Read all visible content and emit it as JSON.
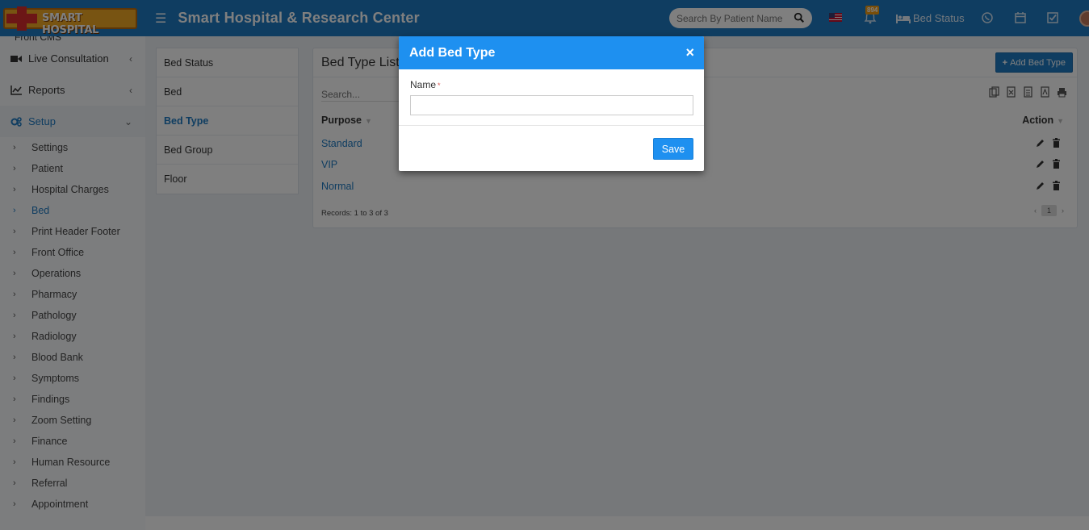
{
  "header": {
    "logo_text": "SMART HOSPITAL",
    "site_title": "Smart Hospital & Research Center",
    "search_placeholder": "Search By Patient Name",
    "notification_count": "894",
    "bed_status_label": "Bed Status",
    "brand_color": "#1e7ac2"
  },
  "sidebar": {
    "partial_top": "Front CMS",
    "items": [
      {
        "label": "Live Consultation",
        "icon": "video-camera-icon"
      },
      {
        "label": "Reports",
        "icon": "line-chart-icon"
      },
      {
        "label": "Setup",
        "icon": "gears-icon"
      }
    ],
    "setup_sub": [
      "Settings",
      "Patient",
      "Hospital Charges",
      "Bed",
      "Print Header Footer",
      "Front Office",
      "Operations",
      "Pharmacy",
      "Pathology",
      "Radiology",
      "Blood Bank",
      "Symptoms",
      "Findings",
      "Zoom Setting",
      "Finance",
      "Human Resource",
      "Referral",
      "Appointment"
    ],
    "active_sub": "Bed"
  },
  "bed_menu": [
    "Bed Status",
    "Bed",
    "Bed Type",
    "Bed Group",
    "Floor"
  ],
  "panel": {
    "title": "Bed Type List",
    "add_button": "Add Bed Type",
    "search_placeholder": "Search...",
    "col_purpose": "Purpose",
    "col_action": "Action",
    "rows": [
      "Standard",
      "VIP",
      "Normal"
    ],
    "records": "Records: 1 to 3 of 3",
    "page": "1",
    "pager_prev": "‹",
    "pager_next": "›"
  },
  "modal": {
    "title": "Add Bed Type",
    "close": "×",
    "field_label": "Name",
    "required_mark": "*",
    "name_value": "",
    "save_label": "Save",
    "header_color": "#1e90f0"
  }
}
